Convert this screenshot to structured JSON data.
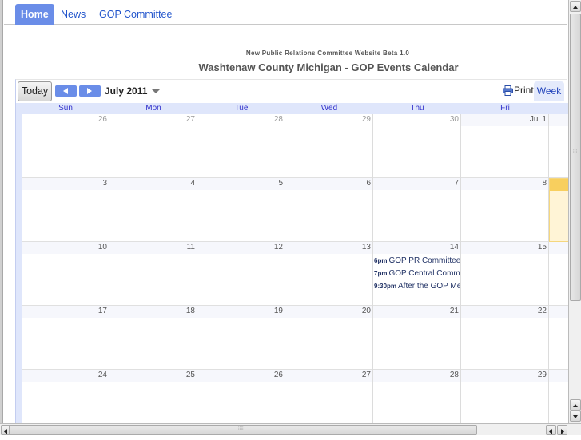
{
  "nav": {
    "tabs": [
      {
        "label": "Home",
        "active": true
      },
      {
        "label": "News",
        "active": false
      },
      {
        "label": "GOP Committee",
        "active": false
      }
    ]
  },
  "header": {
    "subtitle": "New Public Relations Committee Website Beta 1.0",
    "title": "Washtenaw County Michigan - GOP Events Calendar"
  },
  "calendar": {
    "today_label": "Today",
    "prev_icon": "left-triangle-icon",
    "next_icon": "right-triangle-icon",
    "month_label": "July 2011",
    "print_label": "Print",
    "week_label": "Week",
    "colors": {
      "accent": "#6a8de8",
      "today": "#f8cf5e",
      "today_bg": "#fff4d6",
      "header_bg": "#dfe6fb"
    },
    "days_of_week": [
      "Sun",
      "Mon",
      "Tue",
      "Wed",
      "Thu",
      "Fri"
    ],
    "weeks": [
      {
        "days": [
          {
            "num": "26",
            "other": true
          },
          {
            "num": "27",
            "other": true
          },
          {
            "num": "28",
            "other": true
          },
          {
            "num": "29",
            "other": true
          },
          {
            "num": "30",
            "other": true
          },
          {
            "num": "Jul 1",
            "other": false
          }
        ]
      },
      {
        "days": [
          {
            "num": "3"
          },
          {
            "num": "4"
          },
          {
            "num": "5"
          },
          {
            "num": "6"
          },
          {
            "num": "7"
          },
          {
            "num": "8"
          }
        ]
      },
      {
        "days": [
          {
            "num": "10"
          },
          {
            "num": "11"
          },
          {
            "num": "12"
          },
          {
            "num": "13"
          },
          {
            "num": "14",
            "events": [
              {
                "time": "6pm",
                "title": "GOP PR Committee"
              },
              {
                "time": "7pm",
                "title": "GOP Central Committee"
              },
              {
                "time": "9:30pm",
                "title": "After the GOP Meeting"
              }
            ]
          },
          {
            "num": "15"
          }
        ]
      },
      {
        "days": [
          {
            "num": "17"
          },
          {
            "num": "18"
          },
          {
            "num": "19"
          },
          {
            "num": "20"
          },
          {
            "num": "21"
          },
          {
            "num": "22"
          }
        ]
      },
      {
        "days": [
          {
            "num": "24"
          },
          {
            "num": "25"
          },
          {
            "num": "26"
          },
          {
            "num": "27"
          },
          {
            "num": "28"
          },
          {
            "num": "29"
          }
        ]
      }
    ]
  }
}
